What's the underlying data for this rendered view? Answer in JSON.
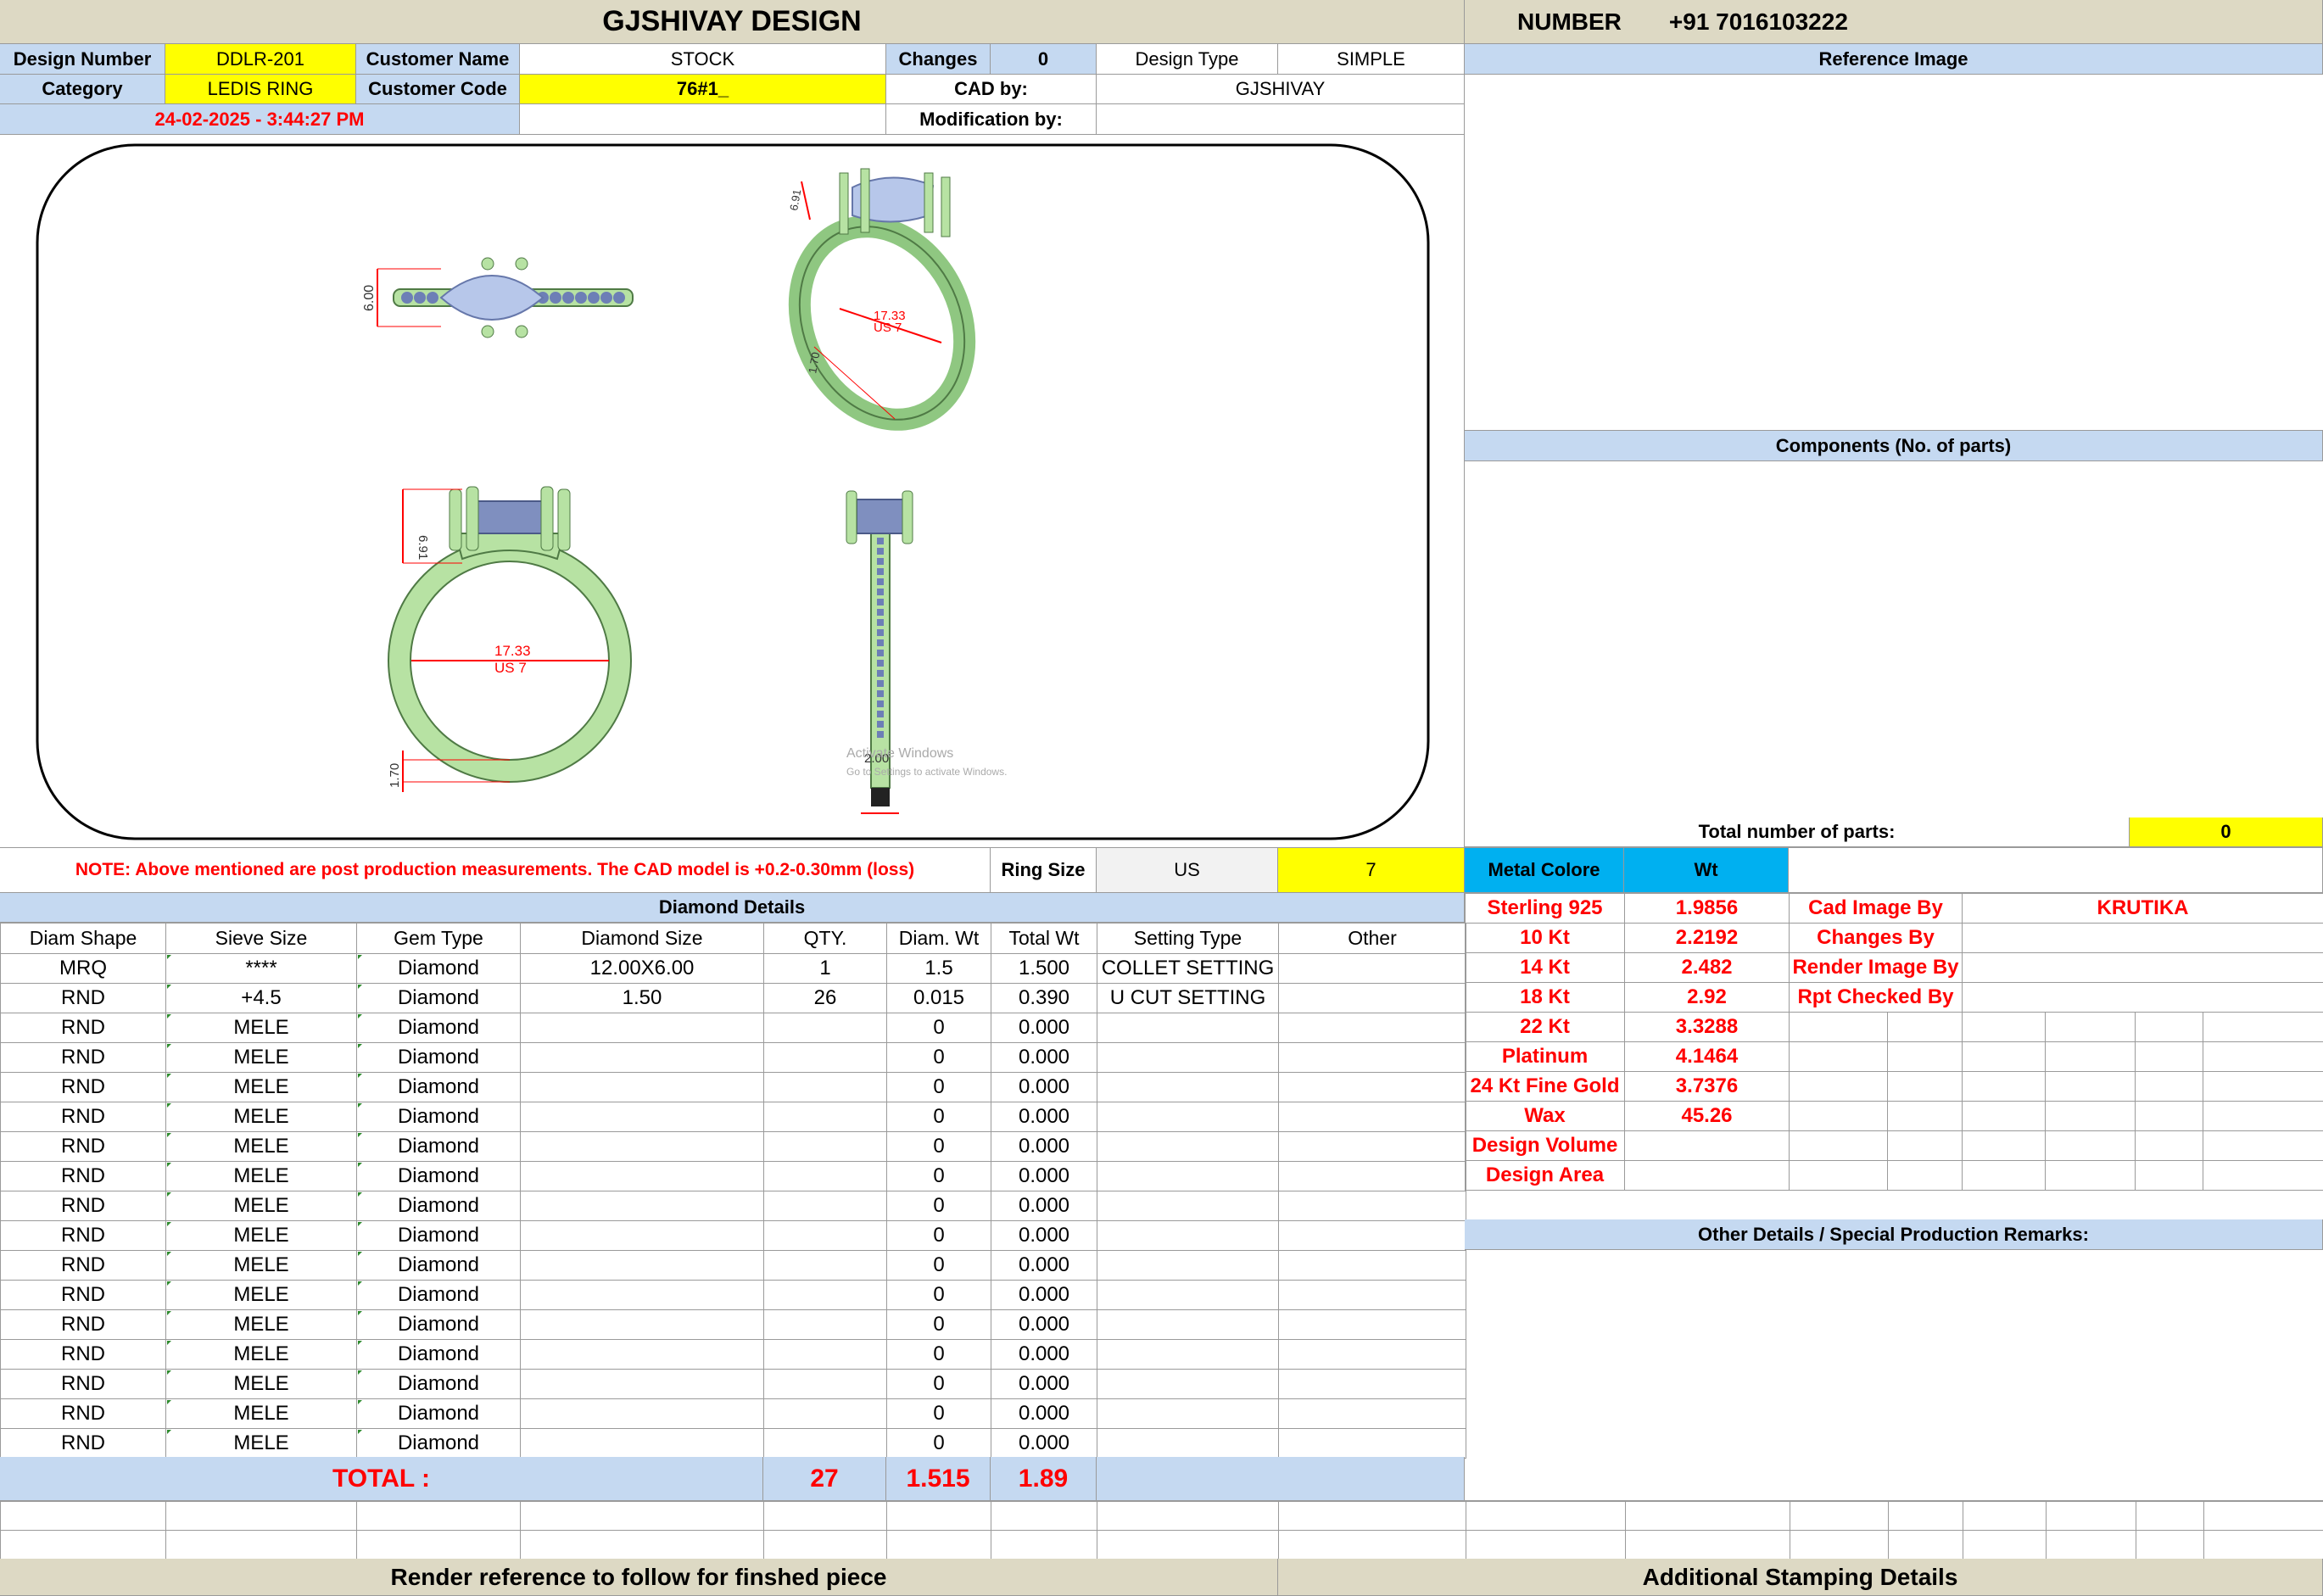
{
  "header": {
    "company": "GJSHIVAY DESIGN",
    "number_label": "NUMBER",
    "phone": "+91 7016103222"
  },
  "info": {
    "design_number_label": "Design Number",
    "design_number": "DDLR-201",
    "customer_name_label": "Customer Name",
    "customer_name": "STOCK",
    "changes_label": "Changes",
    "changes": "0",
    "design_type_label": "Design Type",
    "design_type": "SIMPLE",
    "category_label": "Category",
    "category": "LEDIS RING",
    "customer_code_label": "Customer Code",
    "customer_code": "76#1_",
    "cad_by_label": "CAD by:",
    "cad_by": "GJSHIVAY",
    "datetime": "24-02-2025 - 3:44:27 PM",
    "modification_label": "Modification by:",
    "modification": ""
  },
  "drawing": {
    "top_width": "6.00",
    "side_height": "6.91",
    "ring_dia": "17.33",
    "ring_size": "US 7",
    "band_thick": "1.70",
    "side_width": "2.00",
    "watermark_line1": "Activate Windows",
    "watermark_line2": "Go to Settings to activate Windows."
  },
  "right_panel": {
    "reference_title": "Reference Image",
    "components_title": "Components (No. of parts)",
    "total_parts_label": "Total number of parts:",
    "total_parts": "0"
  },
  "note": {
    "text": "NOTE: Above mentioned are post production measurements. The CAD model is +0.2-0.30mm (loss)",
    "ring_size_label": "Ring Size",
    "ring_size_unit": "US",
    "ring_size_value": "7"
  },
  "metal": {
    "title": "Metal Colore",
    "wt_label": "Wt",
    "rows": [
      {
        "name": "Sterling 925",
        "wt": "1.9856"
      },
      {
        "name": "10 Kt",
        "wt": "2.2192"
      },
      {
        "name": "14 Kt",
        "wt": "2.482"
      },
      {
        "name": "18 Kt",
        "wt": "2.92"
      },
      {
        "name": "22 Kt",
        "wt": "3.3288"
      },
      {
        "name": "Platinum",
        "wt": "4.1464"
      },
      {
        "name": "24 Kt Fine Gold",
        "wt": "3.7376"
      },
      {
        "name": "Wax",
        "wt": "45.26"
      },
      {
        "name": "Design Volume",
        "wt": ""
      },
      {
        "name": "Design Area",
        "wt": ""
      }
    ]
  },
  "credits": {
    "rows": [
      {
        "label": "Cad Image By",
        "value": "KRUTIKA"
      },
      {
        "label": "Changes By",
        "value": ""
      },
      {
        "label": "Render Image By",
        "value": ""
      },
      {
        "label": "Rpt Checked By",
        "value": ""
      }
    ]
  },
  "remarks_title": "Other Details / Special Production Remarks:",
  "diamond": {
    "title": "Diamond Details",
    "headers": [
      "Diam Shape",
      "Sieve Size",
      "Gem Type",
      "Diamond Size",
      "QTY.",
      "Diam. Wt",
      "Total Wt",
      "Setting Type",
      "Other"
    ],
    "rows": [
      [
        "MRQ",
        "****",
        "Diamond",
        "12.00X6.00",
        "1",
        "1.5",
        "1.500",
        "COLLET SETTING",
        ""
      ],
      [
        "RND",
        "+4.5",
        "Diamond",
        "1.50",
        "26",
        "0.015",
        "0.390",
        "U CUT SETTING",
        ""
      ],
      [
        "RND",
        "MELE",
        "Diamond",
        "",
        "",
        "0",
        "0.000",
        "",
        ""
      ],
      [
        "RND",
        "MELE",
        "Diamond",
        "",
        "",
        "0",
        "0.000",
        "",
        ""
      ],
      [
        "RND",
        "MELE",
        "Diamond",
        "",
        "",
        "0",
        "0.000",
        "",
        ""
      ],
      [
        "RND",
        "MELE",
        "Diamond",
        "",
        "",
        "0",
        "0.000",
        "",
        ""
      ],
      [
        "RND",
        "MELE",
        "Diamond",
        "",
        "",
        "0",
        "0.000",
        "",
        ""
      ],
      [
        "RND",
        "MELE",
        "Diamond",
        "",
        "",
        "0",
        "0.000",
        "",
        ""
      ],
      [
        "RND",
        "MELE",
        "Diamond",
        "",
        "",
        "0",
        "0.000",
        "",
        ""
      ],
      [
        "RND",
        "MELE",
        "Diamond",
        "",
        "",
        "0",
        "0.000",
        "",
        ""
      ],
      [
        "RND",
        "MELE",
        "Diamond",
        "",
        "",
        "0",
        "0.000",
        "",
        ""
      ],
      [
        "RND",
        "MELE",
        "Diamond",
        "",
        "",
        "0",
        "0.000",
        "",
        ""
      ],
      [
        "RND",
        "MELE",
        "Diamond",
        "",
        "",
        "0",
        "0.000",
        "",
        ""
      ],
      [
        "RND",
        "MELE",
        "Diamond",
        "",
        "",
        "0",
        "0.000",
        "",
        ""
      ],
      [
        "RND",
        "MELE",
        "Diamond",
        "",
        "",
        "0",
        "0.000",
        "",
        ""
      ],
      [
        "RND",
        "MELE",
        "Diamond",
        "",
        "",
        "0",
        "0.000",
        "",
        ""
      ],
      [
        "RND",
        "MELE",
        "Diamond",
        "",
        "",
        "0",
        "0.000",
        "",
        ""
      ]
    ],
    "total_label": "TOTAL :",
    "total_qty": "27",
    "total_diam_wt": "1.515",
    "total_wt": "1.89"
  },
  "footer": {
    "render_ref": "Render reference to follow for finshed piece",
    "stamping": "Additional Stamping Details"
  }
}
